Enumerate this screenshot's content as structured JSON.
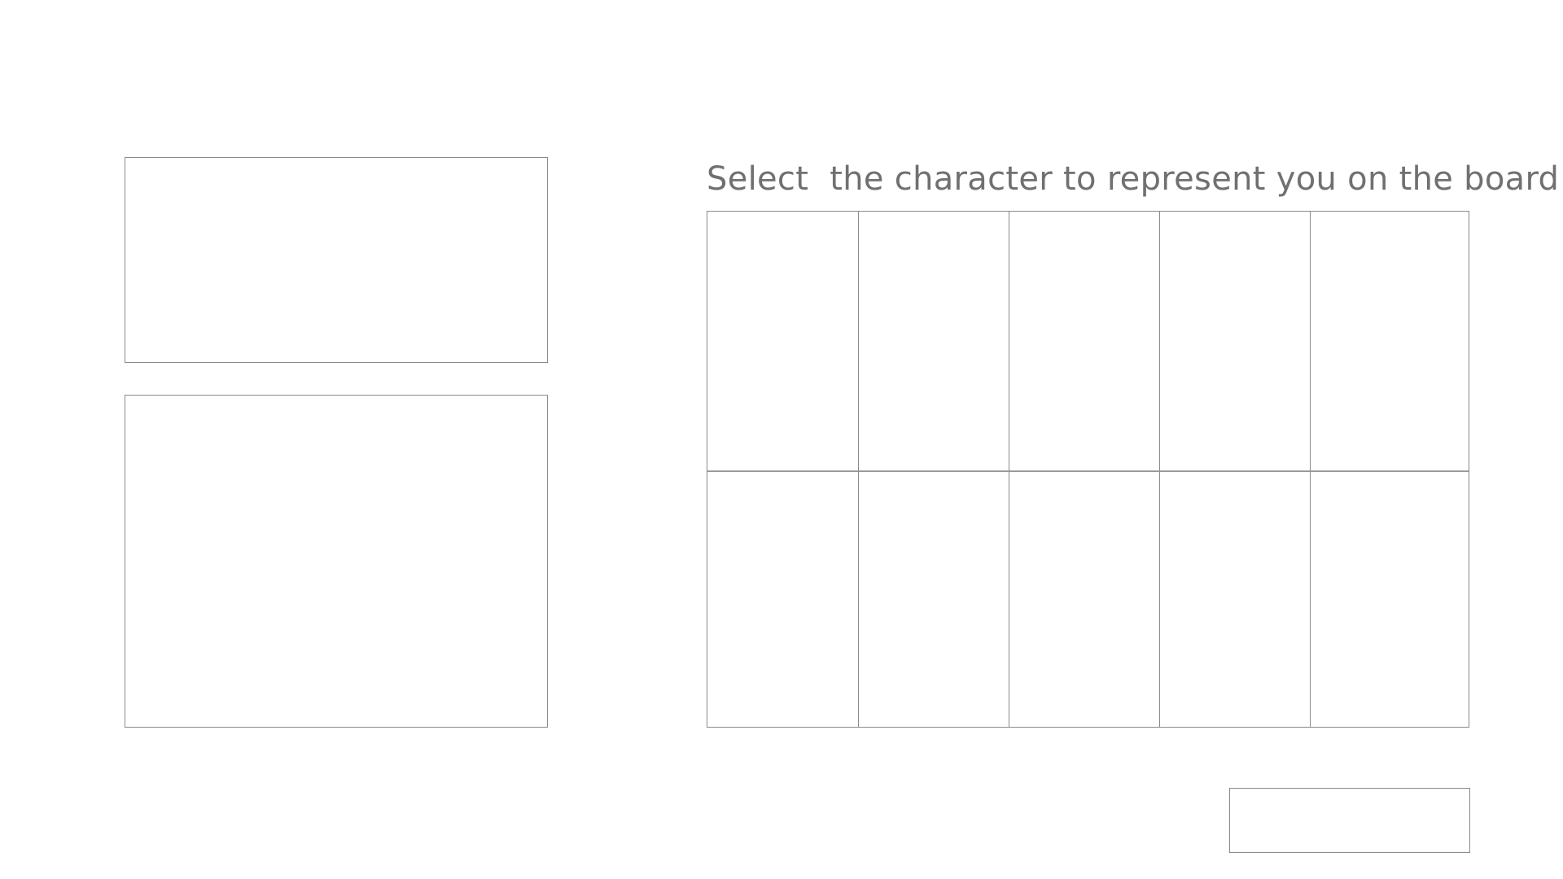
{
  "character_select": {
    "title": "Select  the character to represent you on the board",
    "character_slots": [
      {
        "label": ""
      },
      {
        "label": ""
      },
      {
        "label": ""
      },
      {
        "label": ""
      },
      {
        "label": ""
      },
      {
        "label": ""
      },
      {
        "label": ""
      },
      {
        "label": ""
      },
      {
        "label": ""
      },
      {
        "label": ""
      }
    ],
    "confirm_button": {
      "label": ""
    }
  },
  "left_panels": {
    "top": {
      "text": ""
    },
    "bottom": {
      "text": ""
    }
  },
  "colors": {
    "background": "#ffffff",
    "border": "#8a8a8a",
    "text": "#707070"
  }
}
